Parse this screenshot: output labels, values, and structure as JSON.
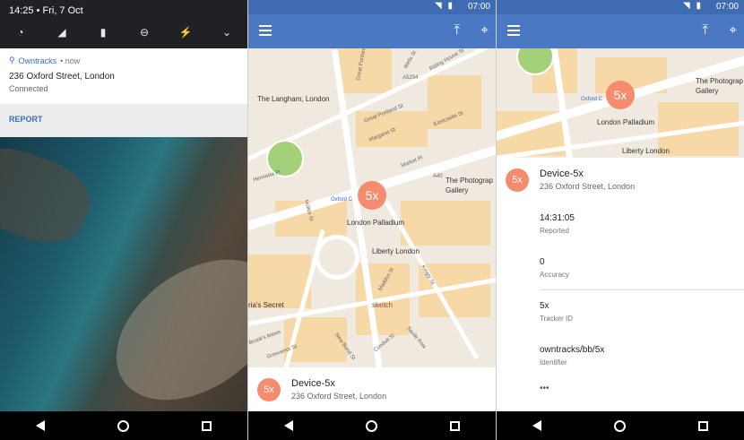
{
  "shade": {
    "time_date": "14:25 • Fri, 7 Oct",
    "qs_icons": [
      "wifi-icon",
      "signal-icon",
      "battery-icon",
      "dnd-icon",
      "flashlight-icon",
      "expand-icon"
    ],
    "qs_glyphs": [
      "◔",
      "◢",
      "▮",
      "⊖",
      "⚡",
      "⌄"
    ]
  },
  "notification": {
    "app": "Owntracks",
    "when": "• now",
    "title": "236 Oxford Street, London",
    "subtitle": "Connected",
    "action": "REPORT"
  },
  "status": {
    "time": "07:00",
    "icons": "◥ ▮"
  },
  "map_labels": {
    "langham": "The Langham, London",
    "palladium": "London Palladium",
    "liberty": "Liberty London",
    "photographers": "The Photograp",
    "gallery": "Gallery",
    "marias": "ria's Secret",
    "sketch": "sketch",
    "oxford_circus": "Oxford C",
    "streets": [
      "Great Portland St",
      "Margaret St",
      "Eastcastle St",
      "Market Pl",
      "Henrietta Pl",
      "Holles St",
      "Maddox St",
      "Kingly St",
      "Brook's Mews",
      "Grosvenor St",
      "New Bond St",
      "Savile Row",
      "Conduit St",
      "A40",
      "Wells St",
      "Riding House St",
      "A5204"
    ]
  },
  "marker": "5x",
  "device": {
    "name": "Device-5x",
    "address": "236 Oxford Street, London"
  },
  "details": [
    {
      "value": "14:31:05",
      "label": "Reported"
    },
    {
      "value": "0",
      "label": "Accuracy"
    },
    {
      "value": "5x",
      "label": "Tracker ID"
    },
    {
      "value": "owntracks/bb/5x",
      "label": "Identifier"
    }
  ],
  "more": "•••"
}
